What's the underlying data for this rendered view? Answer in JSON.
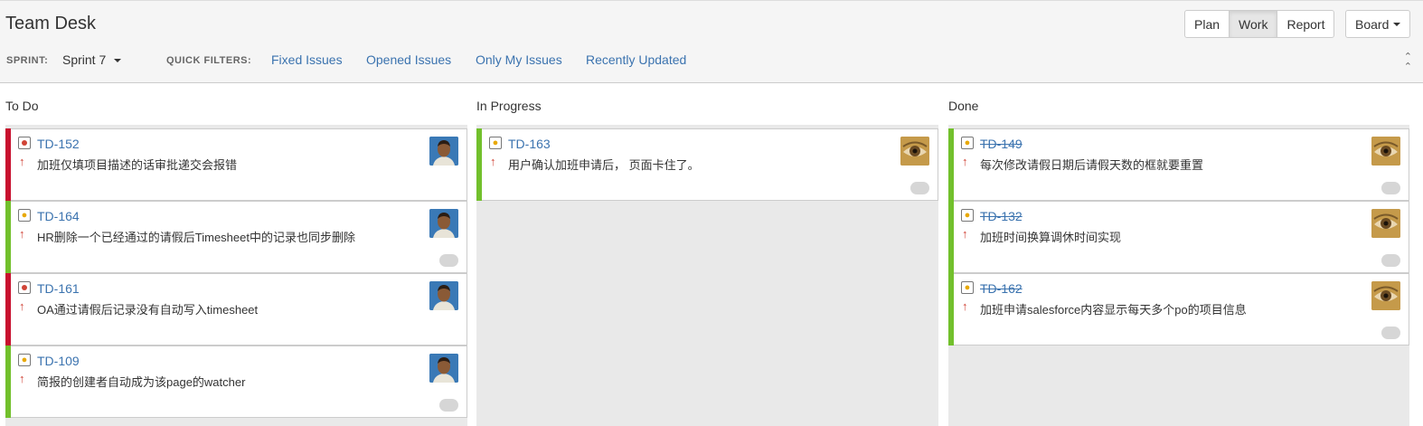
{
  "header": {
    "title": "Team Desk",
    "modes": [
      "Plan",
      "Work",
      "Report"
    ],
    "active_mode": "Work",
    "board_label": "Board"
  },
  "filters": {
    "sprint_label": "SPRINT:",
    "sprint_value": "Sprint 7",
    "quick_filters_label": "QUICK FILTERS:",
    "quick_filters": [
      "Fixed Issues",
      "Opened Issues",
      "Only My Issues",
      "Recently Updated"
    ]
  },
  "colors": {
    "link": "#3b73af",
    "bug_bar": "#c8102e",
    "ok_bar": "#72c02c",
    "priority_arrow": "#d04437"
  },
  "columns": [
    {
      "title": "To Do",
      "cards": [
        {
          "key": "TD-152",
          "type": "bug",
          "priority": "↑",
          "summary": "加班仅填项目描述的话审批递交会报错",
          "avatar": "man-avatar",
          "bar": "bug",
          "done": false
        },
        {
          "key": "TD-164",
          "type": "improvement",
          "priority": "↑",
          "summary": "HR删除一个已经通过的请假后Timesheet中的记录也同步删除",
          "avatar": "man-avatar",
          "bar": "ok",
          "done": false
        },
        {
          "key": "TD-161",
          "type": "bug",
          "priority": "↑",
          "summary": "OA通过请假后记录没有自动写入timesheet",
          "avatar": "man-avatar",
          "bar": "bug",
          "done": false
        },
        {
          "key": "TD-109",
          "type": "improvement",
          "priority": "↑",
          "summary": "简报的创建者自动成为该page的watcher",
          "avatar": "man-avatar",
          "bar": "ok",
          "done": false
        }
      ]
    },
    {
      "title": "In Progress",
      "cards": [
        {
          "key": "TD-163",
          "type": "improvement",
          "priority": "↑",
          "summary": "用户确认加班申请后， 页面卡住了。",
          "avatar": "eye-avatar",
          "bar": "ok",
          "done": false
        }
      ]
    },
    {
      "title": "Done",
      "cards": [
        {
          "key": "TD-149",
          "type": "improvement",
          "priority": "↑",
          "summary": "每次修改请假日期后请假天数的框就要重置",
          "avatar": "eye-avatar",
          "bar": "ok",
          "done": true
        },
        {
          "key": "TD-132",
          "type": "improvement",
          "priority": "↑",
          "summary": "加班时间换算调休时间实现",
          "avatar": "eye-avatar",
          "bar": "ok",
          "done": true
        },
        {
          "key": "TD-162",
          "type": "improvement",
          "priority": "↑",
          "summary": "加班申请salesforce内容显示每天多个po的项目信息",
          "avatar": "eye-avatar",
          "bar": "ok",
          "done": true
        }
      ]
    }
  ]
}
